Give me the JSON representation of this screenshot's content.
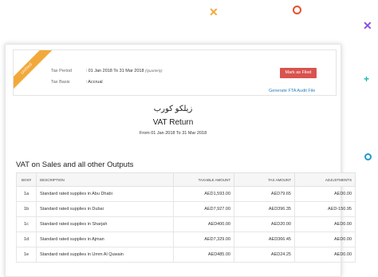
{
  "return_status": "Unfiled",
  "tax_period": {
    "label": "Tax Period",
    "value": ": 01 Jan 2018  To  31 Mar 2018",
    "note": "(Quarterly)"
  },
  "tax_basis": {
    "label": "Tax Basis",
    "value": ": Accrual"
  },
  "actions": {
    "mark_filed": "Mark as Filed",
    "fta_audit": "Generate FTA Audit File"
  },
  "header": {
    "org_name_arabic": "زيلكو كورب",
    "title": "VAT Return",
    "date_range": "From 01 Jan 2018  To  31 Mar 2018"
  },
  "section_title": "VAT on Sales and all other Outputs",
  "table": {
    "columns": [
      "BOX#",
      "DESCRIPTION",
      "TAXABLE AMOUNT",
      "TAX AMOUNT",
      "ADJUSTMENTS"
    ],
    "rows": [
      {
        "box": "1a",
        "description": "Standard rated supplies in Abu Dhabi",
        "taxable": "AED1,593.00",
        "tax": "AED79.65",
        "adjustments": "AED0.00"
      },
      {
        "box": "1b",
        "description": "Standard rated supplies in Dubai",
        "taxable": "AED7,927.00",
        "tax": "AED396.35",
        "adjustments": "AED-150.95"
      },
      {
        "box": "1c",
        "description": "Standard rated supplies in Sharjah",
        "taxable": "AED400.00",
        "tax": "AED20.00",
        "adjustments": "AED0.00"
      },
      {
        "box": "1d",
        "description": "Standard rated supplies in Ajman",
        "taxable": "AED7,329.00",
        "tax": "AED366.45",
        "adjustments": "AED0.00"
      },
      {
        "box": "1e",
        "description": "Standard rated supplies in Umm Al Quwain",
        "taxable": "AED485.00",
        "tax": "AED24.25",
        "adjustments": "AED0.00"
      }
    ]
  },
  "colors": {
    "accent": "#d9534f",
    "ribbon": "#f2a93b",
    "link": "#2b7dbf"
  },
  "decorations": [
    "cross-orange",
    "ring-red",
    "cross-purple",
    "plus-teal",
    "ring-blue"
  ]
}
